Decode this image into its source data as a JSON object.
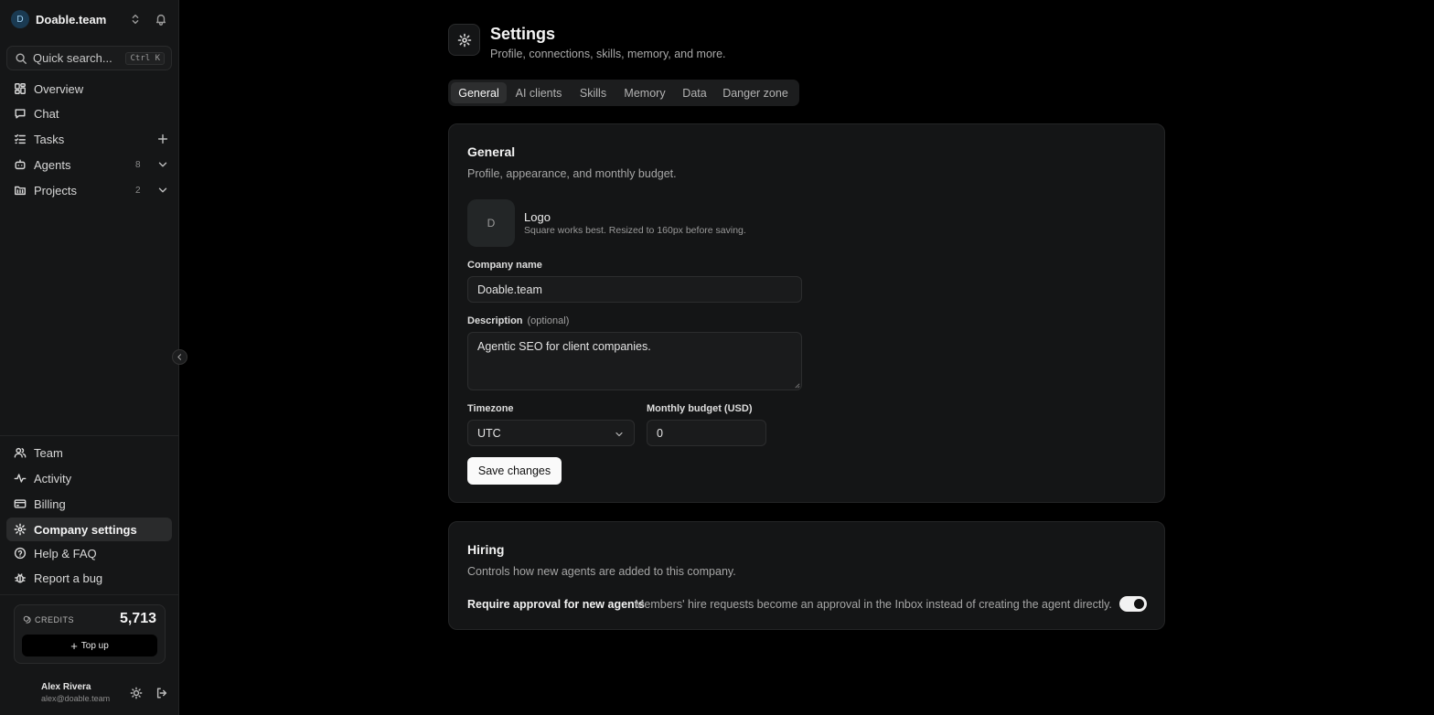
{
  "workspace": {
    "initial": "D",
    "name": "Doable.team"
  },
  "search": {
    "label": "Quick search...",
    "shortcut": "Ctrl K"
  },
  "nav_top": [
    {
      "label": "Overview"
    },
    {
      "label": "Chat"
    },
    {
      "label": "Tasks"
    },
    {
      "label": "Agents",
      "count": "8"
    },
    {
      "label": "Projects",
      "count": "2"
    }
  ],
  "nav_bottom": [
    {
      "label": "Team"
    },
    {
      "label": "Activity"
    },
    {
      "label": "Billing"
    },
    {
      "label": "Company settings",
      "active": true
    },
    {
      "label": "Help & FAQ"
    },
    {
      "label": "Report a bug"
    }
  ],
  "credits": {
    "label": "CREDITS",
    "value": "5,713",
    "topup_label": "Top up"
  },
  "user": {
    "name": "Alex Rivera",
    "email": "alex@doable.team"
  },
  "page": {
    "title": "Settings",
    "subtitle": "Profile, connections, skills, memory, and more."
  },
  "tabs": [
    {
      "label": "General",
      "active": true
    },
    {
      "label": "AI clients"
    },
    {
      "label": "Skills"
    },
    {
      "label": "Memory"
    },
    {
      "label": "Data"
    },
    {
      "label": "Danger zone"
    }
  ],
  "general": {
    "title": "General",
    "description": "Profile, appearance, and monthly budget.",
    "logo_initial": "D",
    "logo_label": "Logo",
    "logo_hint": "Square works best. Resized to 160px before saving.",
    "company_name_label": "Company name",
    "company_name_value": "Doable.team",
    "description_label": "Description",
    "description_optional": "(optional)",
    "description_value": "Agentic SEO for client companies.",
    "timezone_label": "Timezone",
    "timezone_value": "UTC",
    "budget_label": "Monthly budget (USD)",
    "budget_value": "0",
    "save_label": "Save changes"
  },
  "hiring": {
    "title": "Hiring",
    "description": "Controls how new agents are added to this company.",
    "approval_label": "Require approval for new agents",
    "approval_desc": "Members' hire requests become an approval in the Inbox instead of creating the agent directly.",
    "approval_enabled": true
  }
}
